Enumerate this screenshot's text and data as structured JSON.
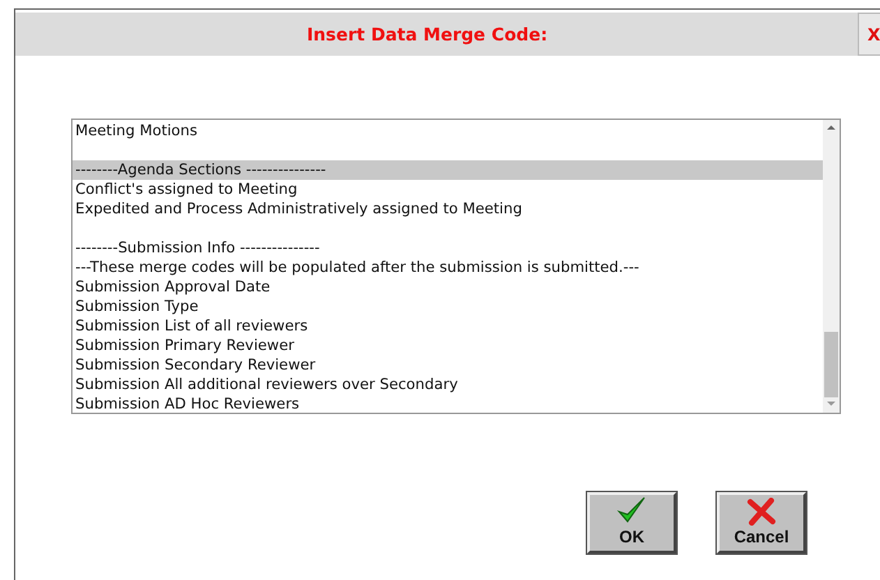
{
  "dialog": {
    "title": "Insert Data Merge Code:",
    "close": "X"
  },
  "list": {
    "items": [
      {
        "kind": "option",
        "label": "Meeting Motions",
        "selected": false
      },
      {
        "kind": "spacer"
      },
      {
        "kind": "option",
        "label": "--------Agenda Sections ---------------",
        "selected": true
      },
      {
        "kind": "option",
        "label": "Conflict's assigned to Meeting",
        "selected": false
      },
      {
        "kind": "option",
        "label": "Expedited and Process Administratively assigned to Meeting",
        "selected": false
      },
      {
        "kind": "spacer"
      },
      {
        "kind": "option",
        "label": "--------Submission Info ---------------",
        "selected": false
      },
      {
        "kind": "option",
        "label": "---These merge codes will be populated after the submission is submitted.---",
        "selected": false
      },
      {
        "kind": "option",
        "label": "Submission Approval Date",
        "selected": false
      },
      {
        "kind": "option",
        "label": "Submission Type",
        "selected": false
      },
      {
        "kind": "option",
        "label": "Submission List of all reviewers",
        "selected": false
      },
      {
        "kind": "option",
        "label": "Submission Primary Reviewer",
        "selected": false
      },
      {
        "kind": "option",
        "label": "Submission Secondary Reviewer",
        "selected": false
      },
      {
        "kind": "option",
        "label": "Submission All additional reviewers over Secondary",
        "selected": false
      },
      {
        "kind": "option",
        "label": "Submission AD Hoc Reviewers",
        "selected": false
      }
    ]
  },
  "buttons": [
    {
      "kind": "ok",
      "label": "OK"
    },
    {
      "kind": "cancel",
      "label": "Cancel"
    }
  ]
}
